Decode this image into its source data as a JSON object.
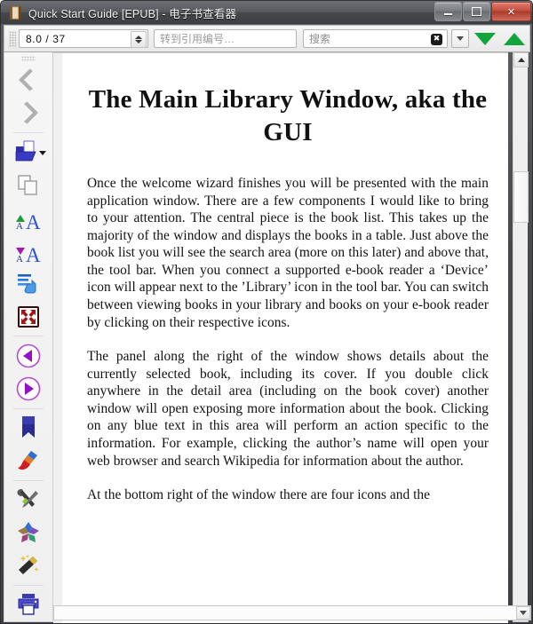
{
  "window": {
    "title": "Quick Start Guide [EPUB] - 电子书查看器",
    "app_icon": "book-icon",
    "controls": {
      "minimize": "minimize-button",
      "maximize": "maximize-button",
      "close_label": "✕"
    }
  },
  "toolbar": {
    "position_value": "8.0 / 37",
    "goto_placeholder": "转到引用编号…",
    "search_placeholder": "搜索",
    "clear_glyph": "✖",
    "buttons": [
      {
        "name": "next-match-button",
        "icon": "triangle-down-icon",
        "color": "#12a53c"
      },
      {
        "name": "previous-match-button",
        "icon": "triangle-up-icon",
        "color": "#12a53c"
      },
      {
        "name": "bookmark-ribbon-button",
        "icon": "ribbon-icon",
        "color": "#e8a317"
      }
    ]
  },
  "sidebar": {
    "items": [
      {
        "name": "back-button",
        "icon": "chevron-left-icon",
        "label": "Back"
      },
      {
        "name": "forward-button",
        "icon": "chevron-right-icon",
        "label": "Forward"
      },
      {
        "name": "open-book-button",
        "icon": "open-folder-icon",
        "label": "Open ebook"
      },
      {
        "name": "copy-button",
        "icon": "copy-pages-icon",
        "label": "Copy"
      },
      {
        "name": "increase-font-button",
        "icon": "increase-font-size-icon",
        "label": "Increase font size"
      },
      {
        "name": "decrease-font-button",
        "icon": "decrease-font-size-icon",
        "label": "Decrease font size"
      },
      {
        "name": "toc-button",
        "icon": "table-of-contents-icon",
        "label": "Table of Contents"
      },
      {
        "name": "fullscreen-button",
        "icon": "fullscreen-icon",
        "label": "Full screen"
      },
      {
        "name": "previous-page-button",
        "icon": "circle-left-arrow-icon",
        "label": "Previous page"
      },
      {
        "name": "next-page-button",
        "icon": "circle-right-arrow-icon",
        "label": "Next page"
      },
      {
        "name": "bookmark-button",
        "icon": "bookmark-icon",
        "label": "Bookmark"
      },
      {
        "name": "highlight-button",
        "icon": "paintbrush-icon",
        "label": "Highlight"
      },
      {
        "name": "preferences-button",
        "icon": "wrench-screwdriver-icon",
        "label": "Preferences"
      },
      {
        "name": "reference-mode-button",
        "icon": "colored-flower-icon",
        "label": "Reference mode"
      },
      {
        "name": "inspector-button",
        "icon": "magic-wand-icon",
        "label": "Inspector"
      },
      {
        "name": "print-button",
        "icon": "printer-icon",
        "label": "Print"
      }
    ]
  },
  "document": {
    "title": "The Main Library Window, aka the GUI",
    "paragraphs": [
      "Once the welcome wizard finishes you will be presented with the main application window. There are a few components I would like to bring to your attention. The central piece is the book list. This takes up the majority of the window and displays the books in a table. Just above the book list you will see the search area (more on this later) and above that, the tool bar. When you connect a supported e-book reader a ‘Device’ icon will appear next to the ’Library’ icon in the tool bar. You can switch between viewing books in your library and books on your e-book reader by clicking on their respective icons.",
      "The panel along the right of the window shows details about the currently selected book, including its cover. If you double click anywhere in the detail area (including on the book cover) another window will open exposing more information about the book. Clicking on any blue text in this area will perform an action specific to the information. For example, clicking the author’s name will open your web browser and search Wikipedia for information about the author.",
      "At the bottom right of the window there are four icons and the"
    ]
  },
  "scrollbars": {
    "vertical": {
      "up_icon": "scroll-up-icon",
      "down_icon": "scroll-down-icon"
    },
    "horizontal": {
      "end_icon": "scroll-right-icon"
    }
  }
}
